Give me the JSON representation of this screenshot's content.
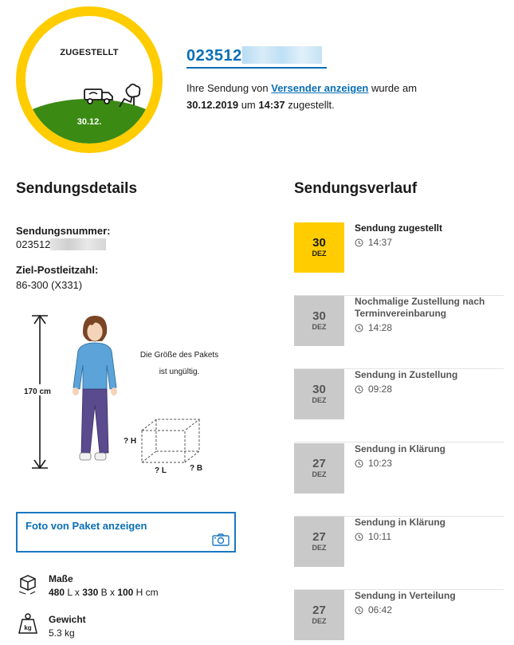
{
  "status": {
    "label": "ZUGESTELLT",
    "date": "30.12."
  },
  "header": {
    "tracking_number_visible": "023512",
    "text_prefix": "Ihre Sendung von ",
    "sender_link": "Versender anzeigen",
    "text_middle": " wurde am",
    "delivery_date": "30.12.2019",
    "text_um": " um ",
    "delivery_time": "14:37",
    "text_suffix": " zugestellt."
  },
  "details": {
    "heading": "Sendungsdetails",
    "sendungsnummer_label": "Sendungsnummer:",
    "sendungsnummer_value": "023512",
    "plz_label": "Ziel-Postleitzahl:",
    "plz_value": "86-300 (X331)",
    "size_height": "170 cm",
    "size_invalid_text": "Die Größe des Pakets ist ungültig.",
    "dim_h": "? H",
    "dim_l": "? L",
    "dim_b": "? B",
    "photo_button": "Foto von Paket anzeigen",
    "masse_label": "Maße",
    "masse_l": "480",
    "masse_b": "330",
    "masse_h": "100",
    "masse_l_unit": " L x ",
    "masse_b_unit": " B x ",
    "masse_h_unit": " H cm",
    "gewicht_label": "Gewicht",
    "gewicht_value": "5.3 kg",
    "kg_icon_text": "kg"
  },
  "history": {
    "heading": "Sendungsverlauf",
    "events": [
      {
        "day": "30",
        "month": "DEZ",
        "title": "Sendung zugestellt",
        "time": "14:37",
        "active": true
      },
      {
        "day": "30",
        "month": "DEZ",
        "title": "Nochmalige Zustellung nach Terminvereinbarung",
        "time": "14:28",
        "active": false
      },
      {
        "day": "30",
        "month": "DEZ",
        "title": "Sendung in Zustellung",
        "time": "09:28",
        "active": false
      },
      {
        "day": "27",
        "month": "DEZ",
        "title": "Sendung in Klärung",
        "time": "10:23",
        "active": false
      },
      {
        "day": "27",
        "month": "DEZ",
        "title": "Sendung in Klärung",
        "time": "10:11",
        "active": false
      },
      {
        "day": "27",
        "month": "DEZ",
        "title": "Sendung in Verteilung",
        "time": "06:42",
        "active": false
      }
    ]
  },
  "colors": {
    "accent_yellow": "#ffcc00",
    "link_blue": "#0a6fb6",
    "hill_green": "#3b8a14",
    "inactive_grey": "#c9c9c9"
  }
}
